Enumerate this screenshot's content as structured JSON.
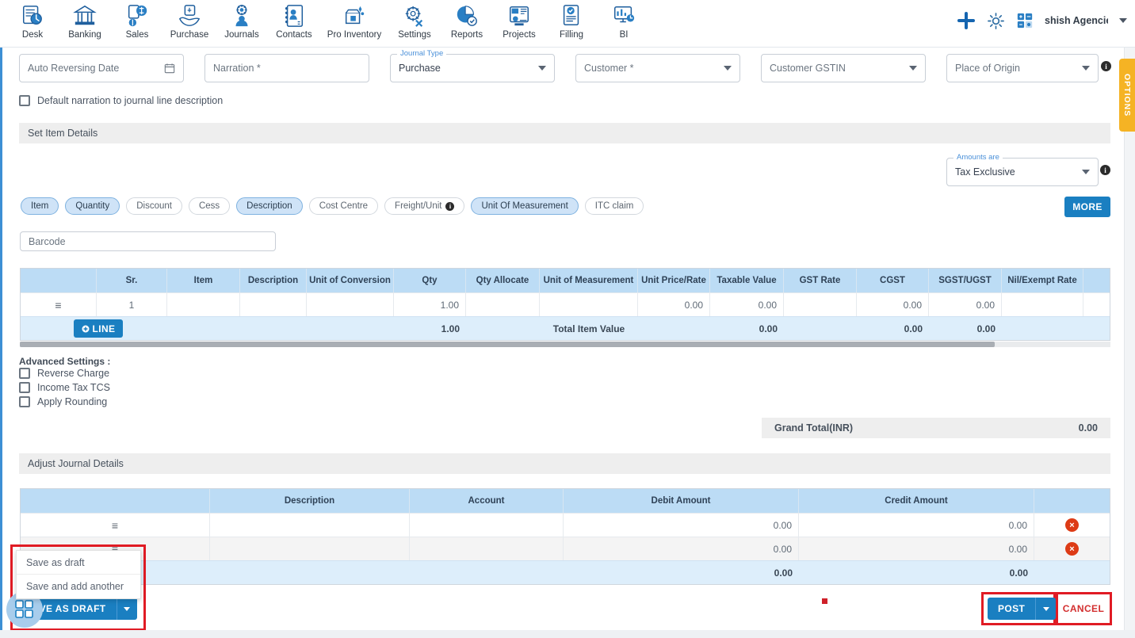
{
  "nav": {
    "items": [
      {
        "label": "Desk",
        "icon": "desk-icon"
      },
      {
        "label": "Banking",
        "icon": "bank-icon"
      },
      {
        "label": "Sales",
        "icon": "sales-icon"
      },
      {
        "label": "Purchase",
        "icon": "purchase-icon"
      },
      {
        "label": "Journals",
        "icon": "journals-icon"
      },
      {
        "label": "Contacts",
        "icon": "contacts-icon"
      },
      {
        "label": "Pro Inventory",
        "icon": "inventory-icon"
      },
      {
        "label": "Settings",
        "icon": "settings-icon"
      },
      {
        "label": "Reports",
        "icon": "reports-icon"
      },
      {
        "label": "Projects",
        "icon": "projects-icon"
      },
      {
        "label": "Filling",
        "icon": "filling-icon"
      },
      {
        "label": "BI",
        "icon": "bi-icon"
      }
    ],
    "right": {
      "add_icon": "plus-icon",
      "settings_icon": "gear-icon",
      "calculator_icon": "calculator-icon",
      "company": "shish Agencie",
      "caret": "chevron-down-icon"
    }
  },
  "form": {
    "auto_reversing_date": {
      "placeholder": "Auto Reversing Date",
      "value": "",
      "icon": "calendar-icon"
    },
    "narration": {
      "placeholder": "Narration *",
      "value": ""
    },
    "journal_type": {
      "legend": "Journal Type",
      "value": "Purchase"
    },
    "customer": {
      "placeholder": "Customer *",
      "value": ""
    },
    "customer_gstin": {
      "placeholder": "Customer GSTIN",
      "value": ""
    },
    "place_of_origin": {
      "placeholder": "Place of Origin",
      "value": ""
    },
    "default_narration_checkbox": {
      "label": "Default narration to journal line description",
      "checked": false
    }
  },
  "set_item_details": {
    "title": "Set Item Details",
    "amounts_are": {
      "legend": "Amounts are",
      "value": "Tax Exclusive"
    },
    "more_button": "MORE",
    "chips": [
      {
        "label": "Item",
        "selected": true
      },
      {
        "label": "Quantity",
        "selected": true
      },
      {
        "label": "Discount",
        "selected": false
      },
      {
        "label": "Cess",
        "selected": false
      },
      {
        "label": "Description",
        "selected": true
      },
      {
        "label": "Cost Centre",
        "selected": false
      },
      {
        "label": "Freight/Unit",
        "selected": false,
        "info": true
      },
      {
        "label": "Unit Of Measurement",
        "selected": true
      },
      {
        "label": "ITC claim",
        "selected": false
      }
    ],
    "barcode": {
      "placeholder": "Barcode",
      "value": ""
    }
  },
  "item_table": {
    "columns": [
      "",
      "Sr.",
      "Item",
      "Description",
      "Unit of Conversion",
      "Qty",
      "Qty Allocate",
      "Unit of Measurement",
      "Unit Price/Rate",
      "Taxable Value",
      "GST Rate",
      "CGST",
      "SGST/UGST",
      "Nil/Exempt Rate",
      ""
    ],
    "rows": [
      {
        "handle": "≡",
        "sr": "1",
        "item": "",
        "description": "",
        "unit_of_conversion": "",
        "qty": "1.00",
        "qty_allocate": "",
        "unit_of_measurement": "",
        "unit_price_rate": "0.00",
        "taxable_value": "0.00",
        "gst_rate": "",
        "cgst": "0.00",
        "sgst_ugst": "0.00",
        "nil_exempt_rate": ""
      }
    ],
    "footer": {
      "add_line_button": "LINE",
      "qty_total": "1.00",
      "total_label": "Total Item Value",
      "taxable_total": "0.00",
      "cgst_total": "0.00",
      "sgst_total": "0.00"
    }
  },
  "advanced_settings": {
    "title": "Advanced Settings :",
    "options": [
      {
        "label": "Reverse Charge",
        "checked": false
      },
      {
        "label": "Income Tax TCS",
        "checked": false
      },
      {
        "label": "Apply Rounding",
        "checked": false
      }
    ]
  },
  "grand_total": {
    "label": "Grand Total(INR)",
    "value": "0.00"
  },
  "journal_details": {
    "title": "Adjust Journal Details",
    "columns": [
      "",
      "Description",
      "Account",
      "Debit Amount",
      "Credit Amount",
      ""
    ],
    "rows": [
      {
        "handle": "≡",
        "description": "",
        "account": "",
        "debit": "0.00",
        "credit": "0.00",
        "remove": "×"
      },
      {
        "handle": "≡",
        "description": "",
        "account": "",
        "debit": "0.00",
        "credit": "0.00",
        "remove": "×"
      }
    ],
    "footer": {
      "debit_total": "0.00",
      "credit_total": "0.00"
    }
  },
  "footer_actions": {
    "save_menu": [
      {
        "label": "Save as draft"
      },
      {
        "label": "Save and add another"
      }
    ],
    "save_as_draft_button": "SAVE AS DRAFT",
    "post_button": "POST",
    "cancel_button": "CANCEL",
    "dropdown_caret": "chevron-down-icon"
  },
  "options_tab": {
    "label": "OPTIONS"
  },
  "colors": {
    "accent_blue": "#1a7fc1",
    "table_header": "#bcdcf5",
    "table_footer": "#ddeefb",
    "section_bar": "#eeeeee",
    "highlight_red": "#e01b24",
    "cancel_red": "#d32f2f",
    "options_amber": "#f5b324",
    "delete_red": "#dd3b16"
  }
}
